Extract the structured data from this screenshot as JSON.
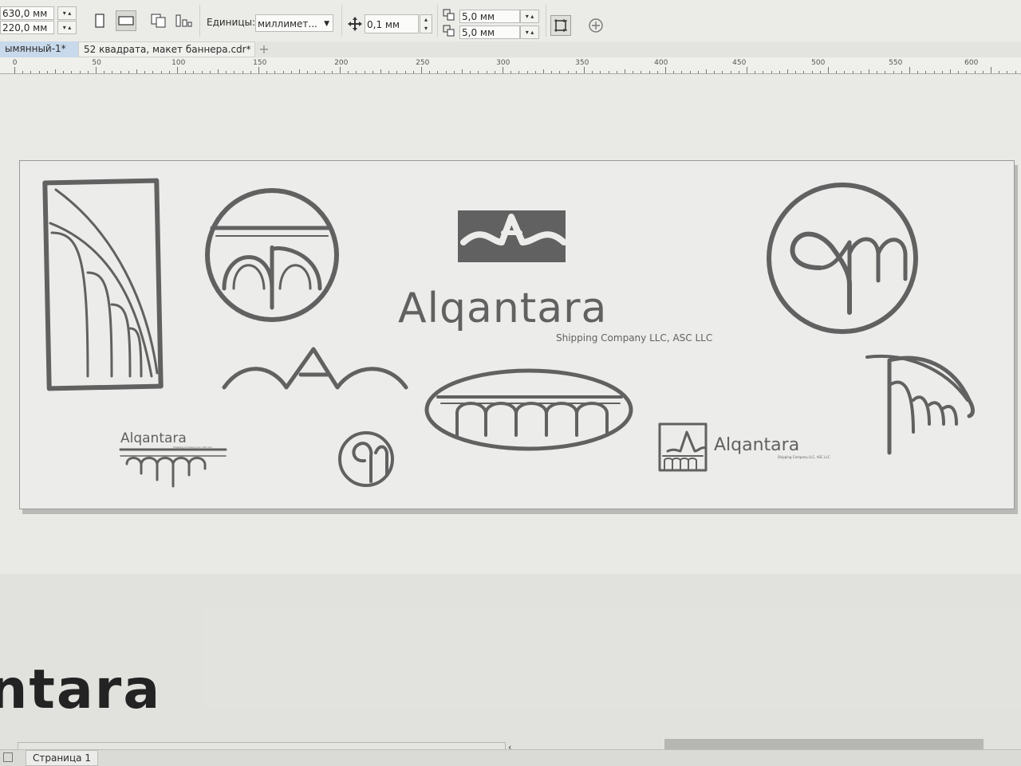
{
  "property_bar": {
    "width_value": "630,0 мм",
    "height_value": "220,0 мм",
    "units_label": "Единицы:",
    "units_value": "миллимет...",
    "nudge_value": "0,1 мм",
    "dup_x_value": "5,0 мм",
    "dup_y_value": "5,0 мм"
  },
  "tabs": [
    {
      "label": "ымянный-1*"
    },
    {
      "label": "52 квадрата, макет баннера.cdr*"
    }
  ],
  "add_tab_label": "+",
  "ruler": {
    "labels": [
      "0",
      "50",
      "100",
      "150",
      "200",
      "250",
      "300",
      "350",
      "400",
      "450",
      "500",
      "550",
      "600"
    ]
  },
  "banner": {
    "brand_name": "Alqantara",
    "tagline": "Shipping Company LLC, ASC LLC",
    "small_logo_name": "Alqantara",
    "small_logo_tagline": "Shipping Company LLC, ASC LLC",
    "right_logo_name": "Alqantara",
    "right_logo_tagline": "Shipping Company LLC, ASC LLC"
  },
  "background_text": "ntara",
  "status_bar": {
    "page_label": "Страница 1"
  },
  "colors": {
    "logo_gray": "#616161",
    "tab_active": "#c7d9ea"
  }
}
